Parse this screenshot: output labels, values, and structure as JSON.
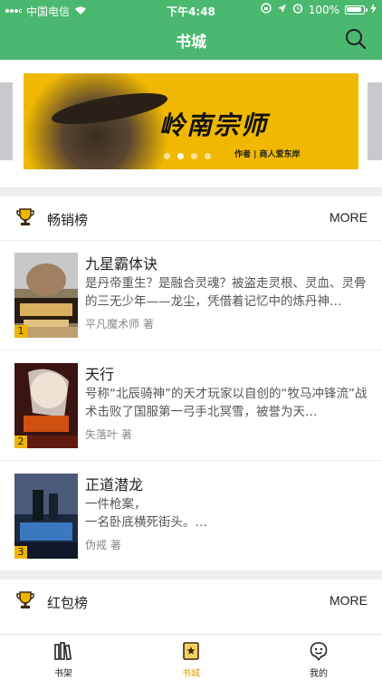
{
  "status_bar": {
    "carrier": "中国电信",
    "time": "下午4:48",
    "battery": "100%"
  },
  "nav": {
    "title": "书城"
  },
  "banner": {
    "title": "岭南宗师",
    "subtitle": "作者 | 商人爱东岸",
    "dots_total": 4,
    "active_dot": 2
  },
  "sections": [
    {
      "title": "畅销榜",
      "more": "MORE"
    },
    {
      "title": "红包榜",
      "more": "MORE"
    }
  ],
  "books": [
    {
      "rank": "1",
      "name": "九星霸体诀",
      "desc": "是丹帝重生？是融合灵魂？被盗走灵根、灵血、灵骨的三无少年——龙尘，凭借着记忆中的炼丹神…",
      "author": "平凡魔术师 著"
    },
    {
      "rank": "2",
      "name": "天行",
      "desc": "号称“北辰骑神”的天才玩家以自创的“牧马冲锋流”战术击败了国服第一弓手北冥雪，被誉为天…",
      "author": "失落叶 著"
    },
    {
      "rank": "3",
      "name": "正道潜龙",
      "desc": "一件枪案，\n    一名卧底横死街头。…",
      "author": "伪戒 著"
    }
  ],
  "tabbar": {
    "tabs": [
      {
        "label": "书架"
      },
      {
        "label": "书城"
      },
      {
        "label": "我的"
      }
    ],
    "active_color": "#e0a000"
  },
  "colors": {
    "brand_green": "#4bb870",
    "accent_gold": "#f0b400"
  }
}
